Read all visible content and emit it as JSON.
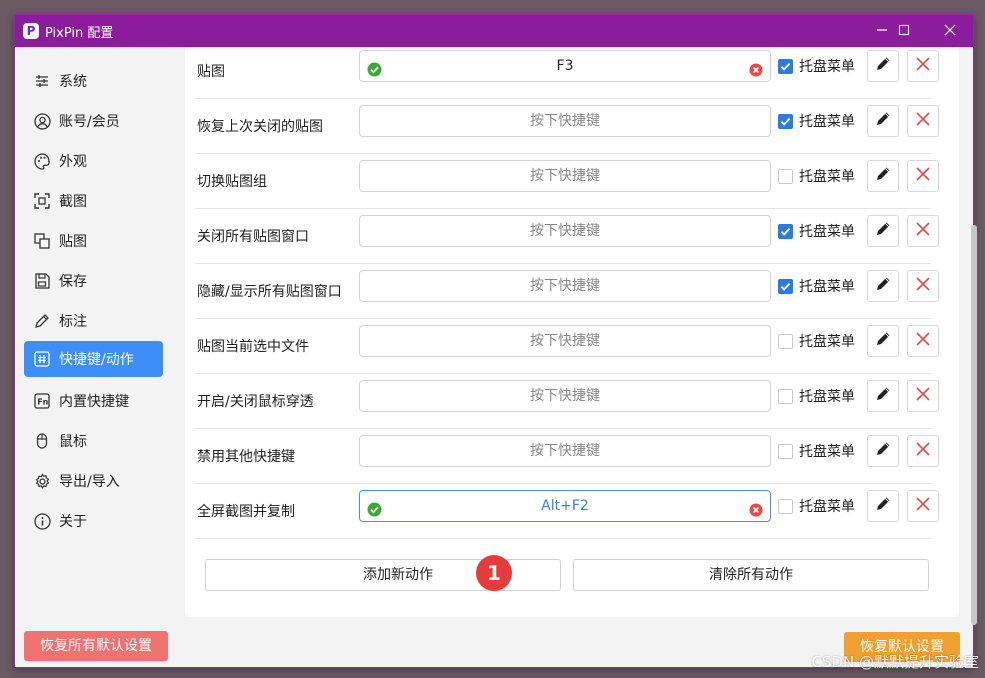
{
  "window": {
    "title": "PixPin 配置",
    "controls": [
      "minimize",
      "maximize",
      "close"
    ]
  },
  "sidebar": {
    "items": [
      {
        "label": "系统",
        "icon": "sliders-icon",
        "active": false
      },
      {
        "label": "账号/会员",
        "icon": "user-icon",
        "active": false
      },
      {
        "label": "外观",
        "icon": "palette-icon",
        "active": false
      },
      {
        "label": "截图",
        "icon": "screenshot-icon",
        "active": false
      },
      {
        "label": "贴图",
        "icon": "pin-image-icon",
        "active": false
      },
      {
        "label": "保存",
        "icon": "save-icon",
        "active": false
      },
      {
        "label": "标注",
        "icon": "pencil-icon",
        "active": false
      },
      {
        "label": "快捷键/动作",
        "icon": "hashtag-icon",
        "active": true
      },
      {
        "label": "内置快捷键",
        "icon": "fn-key-icon",
        "active": false
      },
      {
        "label": "鼠标",
        "icon": "mouse-icon",
        "active": false
      },
      {
        "label": "导出/导入",
        "icon": "gear-icon",
        "active": false
      },
      {
        "label": "关于",
        "icon": "info-icon",
        "active": false
      }
    ],
    "reset_all_label": "恢复所有默认设置"
  },
  "actions": {
    "placeholder": "按下快捷键",
    "tray_label": "托盘菜单",
    "rows": [
      {
        "name": "贴图",
        "key": "F3",
        "tray": true,
        "state": "set"
      },
      {
        "name": "恢复上次关闭的贴图",
        "key": "",
        "tray": true,
        "state": "empty"
      },
      {
        "name": "切换贴图组",
        "key": "",
        "tray": false,
        "state": "empty"
      },
      {
        "name": "关闭所有贴图窗口",
        "key": "",
        "tray": true,
        "state": "empty"
      },
      {
        "name": "隐藏/显示所有贴图窗口",
        "key": "",
        "tray": true,
        "state": "empty"
      },
      {
        "name": "贴图当前选中文件",
        "key": "",
        "tray": false,
        "state": "empty"
      },
      {
        "name": "开启/关闭鼠标穿透",
        "key": "",
        "tray": false,
        "state": "empty"
      },
      {
        "name": "禁用其他快捷键",
        "key": "",
        "tray": false,
        "state": "empty"
      },
      {
        "name": "全屏截图并复制",
        "key": "Alt+F2",
        "tray": false,
        "state": "focused"
      }
    ],
    "add_label": "添加新动作",
    "clear_label": "清除所有动作",
    "badge": "1"
  },
  "footer": {
    "reset_default_label": "恢复默认设置"
  },
  "watermark": "CSDN @默默提升实验室",
  "colors": {
    "titlebar": "#8b1c9b",
    "active_nav": "#3d8ef7",
    "reset_all": "#f27171",
    "reset_default": "#f0a030",
    "badge": "#e53b3b"
  }
}
